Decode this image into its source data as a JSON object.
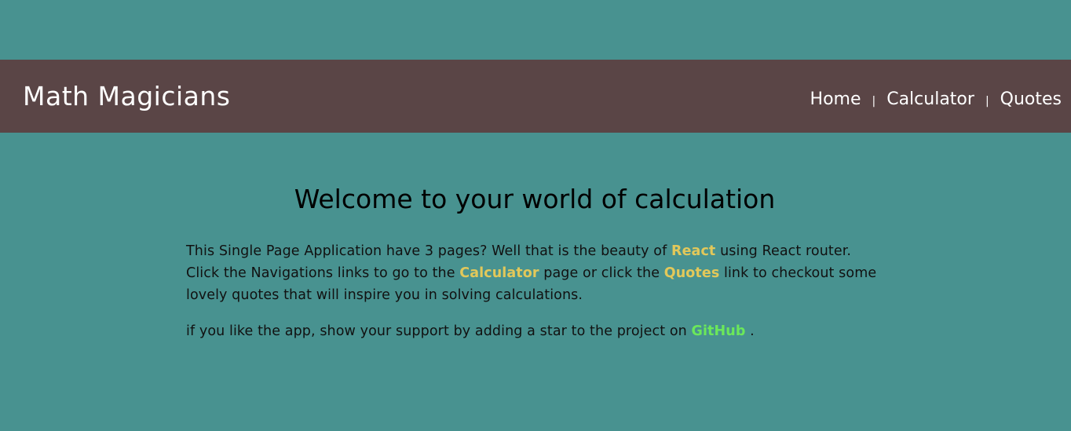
{
  "brand": "Math Magicians",
  "nav": {
    "items": [
      "Home",
      "Calculator",
      "Quotes"
    ],
    "separator": "|"
  },
  "heading": "Welcome to your world of calculation",
  "intro": {
    "t1": "This Single Page Application have 3 pages? Well that is the beauty of ",
    "react": "React",
    "t2": " using React router. Click the Navigations links to go to the ",
    "calculator": "Calculator",
    "t3": " page or click the ",
    "quotes": "Quotes",
    "t4": " link to checkout some lovely quotes that will inspire you in solving calculations."
  },
  "support": {
    "t1": "if you like the app, show your support by adding a star to the project on ",
    "github": "GitHub",
    "t2": " ."
  },
  "colors": {
    "background": "#489290",
    "navbar": "#5a4546",
    "highlight": "#e2c85a",
    "github": "#6be85a"
  }
}
